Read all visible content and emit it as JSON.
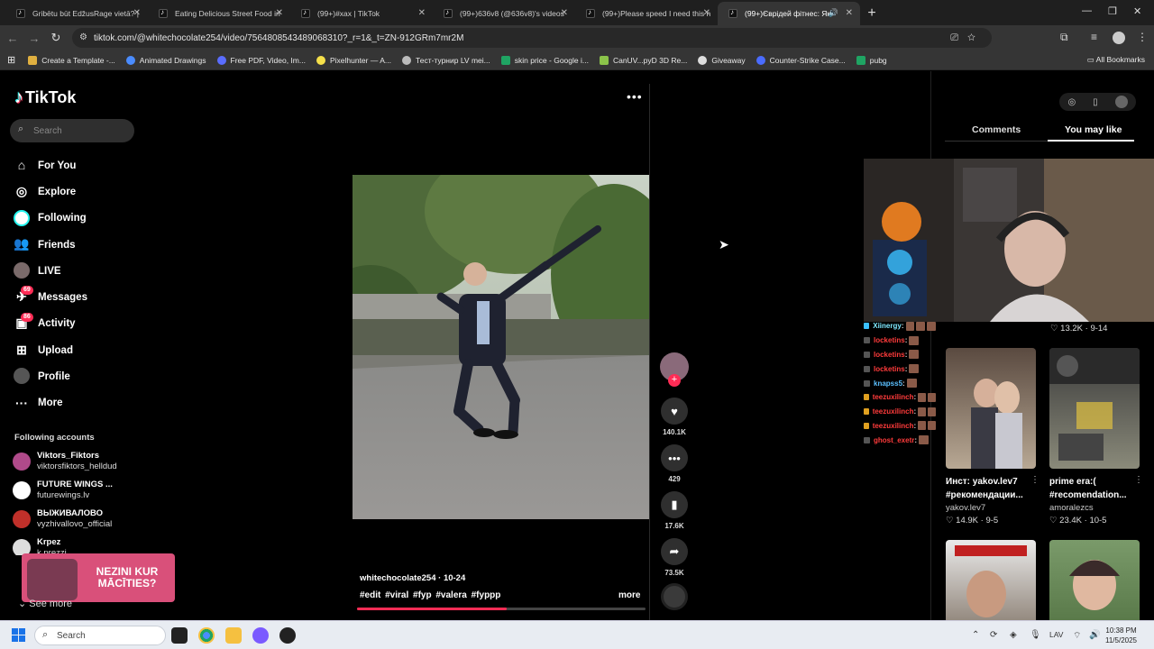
{
  "browser": {
    "tabs": [
      {
        "title": "Gribētu būt EdžusRage vietā? |",
        "active": false
      },
      {
        "title": "Eating Delicious Street Food in",
        "active": false
      },
      {
        "title": "(99+)#xax | TikTok",
        "active": false
      },
      {
        "title": "(99+)636v8 (@636v8)'s videos",
        "active": false
      },
      {
        "title": "(99+)Please speed I need this n",
        "active": false
      },
      {
        "title": "(99+)Єврідей фітнес: Як к",
        "active": true
      }
    ],
    "url": "tiktok.com/@whitechocolate254/video/7564808543489068310?_r=1&_t=ZN-912GRm7mr2M",
    "bookmarks": [
      "Create a Template -...",
      "Animated Drawings",
      "Free PDF, Video, Im...",
      "Pixelhunter — A...",
      "Тест-турнир LV mei...",
      "skin price - Google i...",
      "CanUV...pyD 3D Re...",
      "Giveaway",
      "Counter-Strike Case...",
      "pubg"
    ],
    "all_bookmarks": "All Bookmarks"
  },
  "tiktok": {
    "logo": "TikTok",
    "search_placeholder": "Search",
    "nav": [
      {
        "label": "For You",
        "icon": "home-icon",
        "badge": ""
      },
      {
        "label": "Explore",
        "icon": "compass-icon",
        "badge": ""
      },
      {
        "label": "Following",
        "icon": "following-icon",
        "badge": ""
      },
      {
        "label": "Friends",
        "icon": "friends-icon",
        "badge": ""
      },
      {
        "label": "LIVE",
        "icon": "live-icon",
        "badge": ""
      },
      {
        "label": "Messages",
        "icon": "messages-icon",
        "badge": "69"
      },
      {
        "label": "Activity",
        "icon": "activity-icon",
        "badge": "86"
      },
      {
        "label": "Upload",
        "icon": "upload-icon",
        "badge": ""
      },
      {
        "label": "Profile",
        "icon": "profile-icon",
        "badge": ""
      },
      {
        "label": "More",
        "icon": "more-icon",
        "badge": ""
      }
    ],
    "following_heading": "Following accounts",
    "following_accounts": [
      {
        "name": "Viktors_Fiktors",
        "handle": "viktorsfiktors_helldud"
      },
      {
        "name": "FUTURE WINGS ...",
        "handle": "futurewings.lv"
      },
      {
        "name": "ВЫЖИВАЛОВО",
        "handle": "vyzhivallovo_official"
      },
      {
        "name": "Krpez",
        "handle": "k.prezzi"
      }
    ],
    "ad_text": "NEZINI KUR MĀCĪTIES?",
    "see_more": "See more",
    "video": {
      "author": "whitechocolate254",
      "date": "10-24",
      "hashtags": "#edit #viral #fyp #valera #fyppp",
      "more": "more",
      "progress": 0.52,
      "likes": "140.1K",
      "comments": "429",
      "saves": "17.6K",
      "shares": "73.5K"
    },
    "right_tabs": {
      "comments": "Comments",
      "you_may_like": "You may like"
    },
    "top_card_stats": {
      "views": "13.2K",
      "date": "9-14"
    },
    "chat": [
      {
        "user": "Xiinergy",
        "color": "#7ee8ff"
      },
      {
        "user": "locketins",
        "color": "#ff3b3b"
      },
      {
        "user": "locketins",
        "color": "#ff3b3b"
      },
      {
        "user": "locketins",
        "color": "#ff3b3b"
      },
      {
        "user": "knapss5",
        "color": "#5bc0ff"
      },
      {
        "user": "teezuxilinch",
        "color": "#ff3b3b"
      },
      {
        "user": "teezuxilinch",
        "color": "#ff3b3b"
      },
      {
        "user": "teezuxilinch",
        "color": "#ff3b3b"
      },
      {
        "user": "ghost_exetr",
        "color": "#ff3b3b"
      }
    ],
    "cards": [
      {
        "title": "Инст: yakov.lev7",
        "subtitle": "#рекомендации...",
        "author": "yakov.lev7",
        "views": "14.9K",
        "date": "9-5"
      },
      {
        "title": "prime era:(",
        "subtitle": "#recomendation...",
        "author": "amoralezcs",
        "views": "23.4K",
        "date": "10-5"
      }
    ]
  },
  "taskbar": {
    "search": "Search",
    "lang": "LAV",
    "time": "10:38 PM",
    "date": "11/5/2025"
  }
}
